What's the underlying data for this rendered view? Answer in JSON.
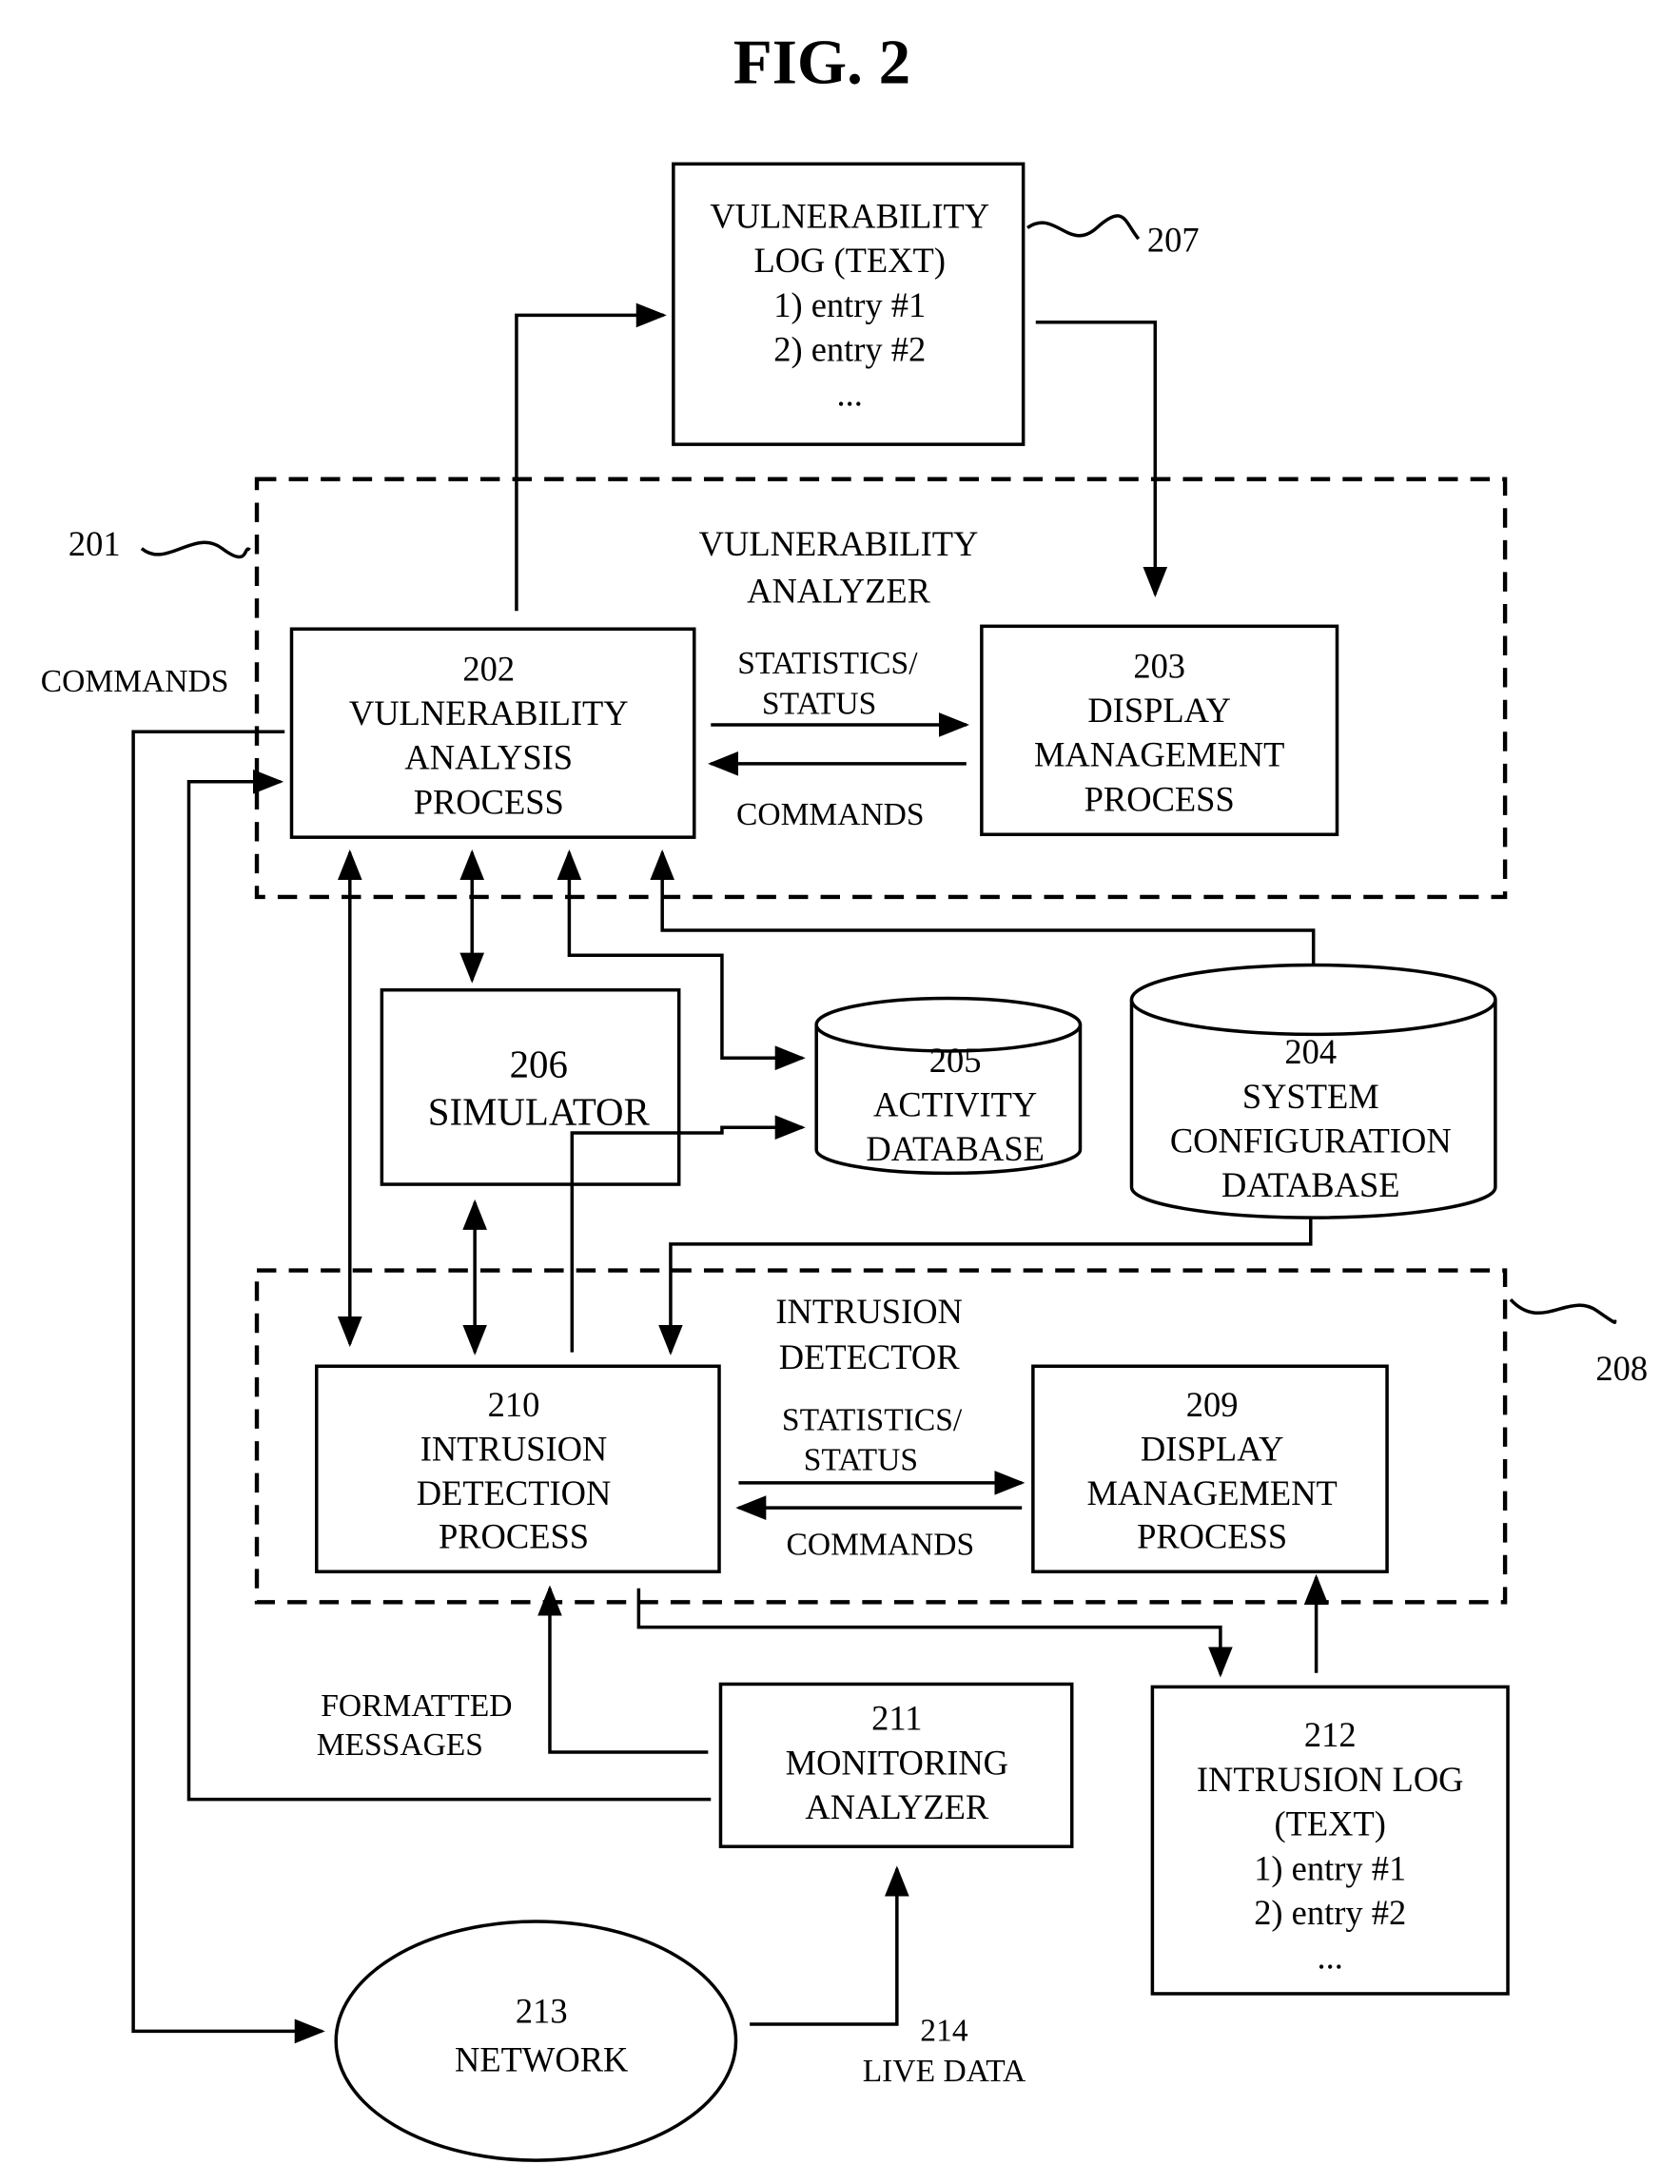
{
  "figure": {
    "title": "FIG. 2"
  },
  "vulnerability_log": {
    "ref": "207",
    "lines": [
      "VULNERABILITY",
      "LOG (TEXT)",
      "1) entry #1",
      "2) entry #2",
      "..."
    ]
  },
  "vulnerability_analyzer": {
    "ref": "201",
    "title_lines": [
      "VULNERABILITY",
      "ANALYZER"
    ],
    "process_202": [
      "202",
      "VULNERABILITY",
      "ANALYSIS",
      "PROCESS"
    ],
    "process_203": [
      "203",
      "DISPLAY",
      "MANAGEMENT",
      "PROCESS"
    ],
    "stats_label": [
      "STATISTICS/",
      "STATUS"
    ],
    "commands_label": "COMMANDS"
  },
  "external_commands_label": "COMMANDS",
  "simulator": [
    "206",
    "SIMULATOR"
  ],
  "activity_db": [
    "205",
    "ACTIVITY",
    "DATABASE"
  ],
  "config_db": [
    "204",
    "SYSTEM",
    "CONFIGURATION",
    "DATABASE"
  ],
  "intrusion_detector": {
    "ref": "208",
    "title_lines": [
      "INTRUSION",
      "DETECTOR"
    ],
    "process_210": [
      "210",
      "INTRUSION",
      "DETECTION",
      "PROCESS"
    ],
    "process_209": [
      "209",
      "DISPLAY",
      "MANAGEMENT",
      "PROCESS"
    ],
    "stats_label": [
      "STATISTICS/",
      "STATUS"
    ],
    "commands_label": "COMMANDS"
  },
  "formatted_messages": [
    "FORMATTED",
    "MESSAGES"
  ],
  "monitoring_analyzer": [
    "211",
    "MONITORING",
    "ANALYZER"
  ],
  "intrusion_log": [
    "212",
    "INTRUSION LOG",
    "(TEXT)",
    "1) entry #1",
    "2) entry #2",
    "..."
  ],
  "network": [
    "213",
    "NETWORK"
  ],
  "live_data": [
    "214",
    "LIVE DATA"
  ]
}
